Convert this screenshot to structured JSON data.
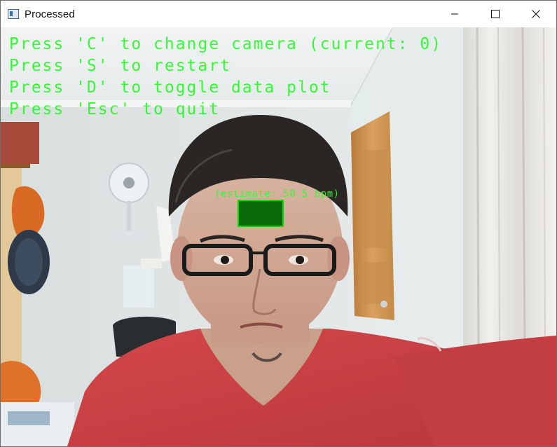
{
  "window": {
    "title": "Processed",
    "app_icon": "window-app-icon",
    "controls": [
      {
        "name": "minimize-button",
        "icon": "minimize-icon"
      },
      {
        "name": "maximize-button",
        "icon": "maximize-icon"
      },
      {
        "name": "close-button",
        "icon": "close-icon"
      }
    ]
  },
  "overlay": {
    "color": "#00ff00",
    "lines": [
      "Press 'C' to change camera (current: 0)",
      "Press 'S' to restart",
      "Press 'D' to toggle data plot",
      "Press 'Esc' to quit"
    ],
    "estimate": "(estimate: 50.5 bpm)"
  }
}
